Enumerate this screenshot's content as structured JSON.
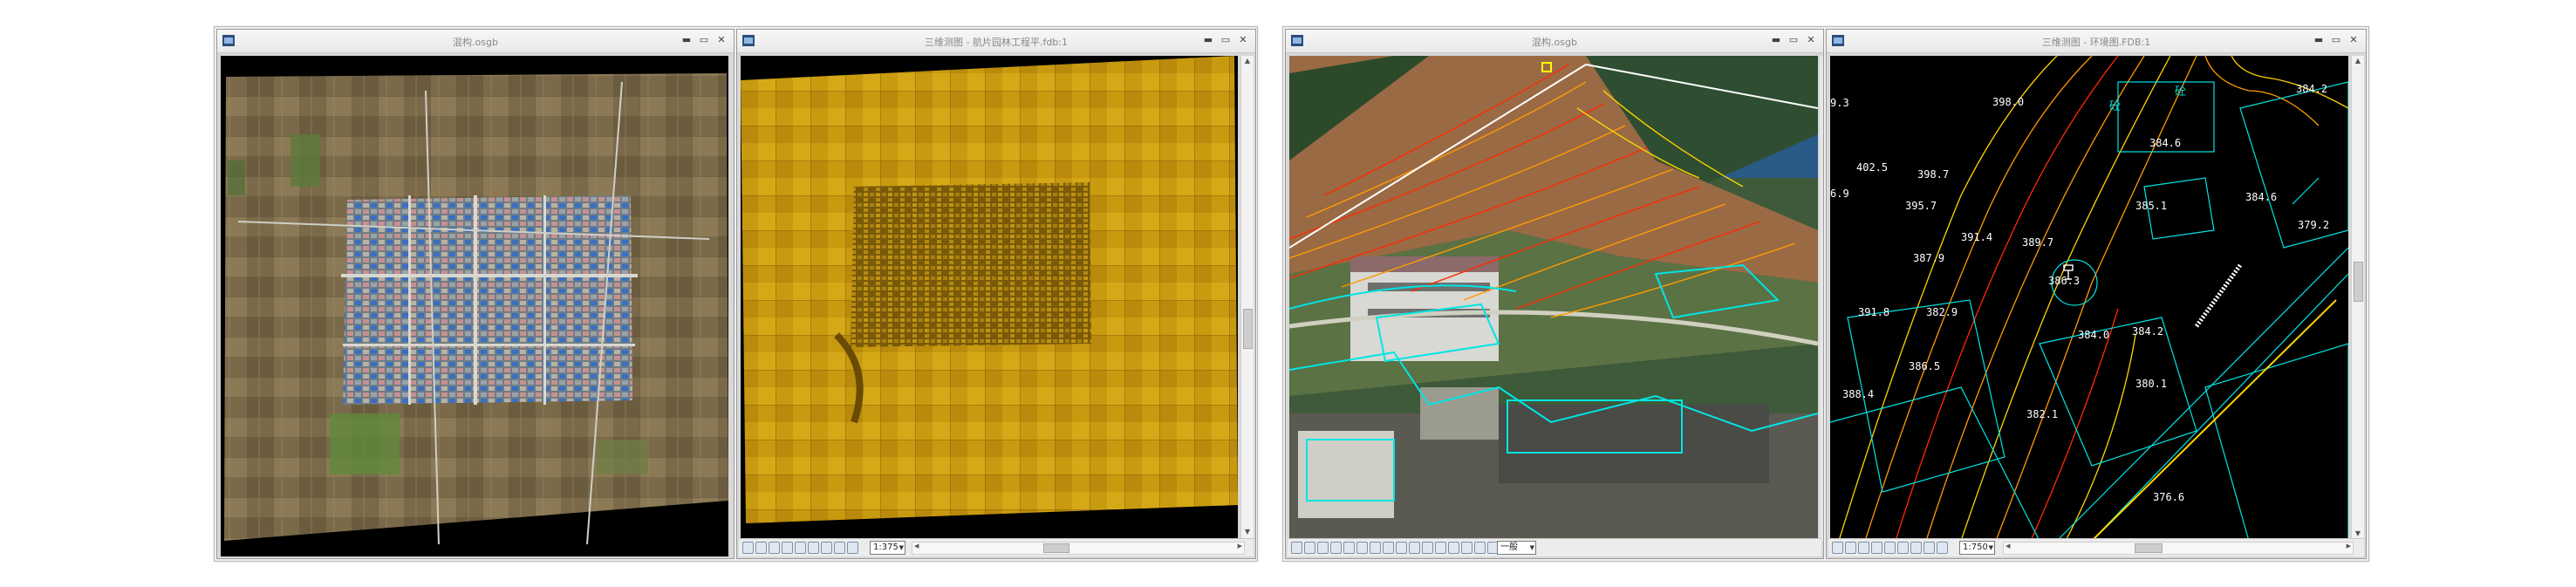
{
  "windows": [
    {
      "title": "混构.osgb",
      "zoom": ""
    },
    {
      "title": "三维测图 - 航片园林工程平.fdb:1",
      "zoom": "1:375"
    },
    {
      "title": "混构.osgb",
      "zoom": "一般"
    },
    {
      "title": "三维测图 - 环境图.FDB:1",
      "zoom": "1:750"
    }
  ],
  "elevations": [
    {
      "value": "398.0"
    },
    {
      "value": "402.5"
    },
    {
      "value": "398.7"
    },
    {
      "value": "395.7"
    },
    {
      "value": "391.4"
    },
    {
      "value": "389.7"
    },
    {
      "value": "387.9"
    },
    {
      "value": "386.3"
    },
    {
      "value": "391.8"
    },
    {
      "value": "382.9"
    },
    {
      "value": "386.5"
    },
    {
      "value": "388.4"
    },
    {
      "value": "384.6"
    },
    {
      "value": "385.1"
    },
    {
      "value": "384.6"
    },
    {
      "value": "384.2"
    },
    {
      "value": "379.2"
    },
    {
      "value": "384.2"
    },
    {
      "value": "384.0"
    },
    {
      "value": "380.1"
    },
    {
      "value": "382.1"
    },
    {
      "value": "376.6"
    },
    {
      "value": "9.3"
    },
    {
      "value": "6.9"
    }
  ],
  "building_labels": [
    "砼",
    "砼"
  ],
  "colors": {
    "contour_red": "#ff2a00",
    "contour_orange": "#ff9a00",
    "contour_yellow": "#ffd400",
    "building_cyan": "#00e5e5",
    "pointcloud_gold": "#c89a10"
  }
}
